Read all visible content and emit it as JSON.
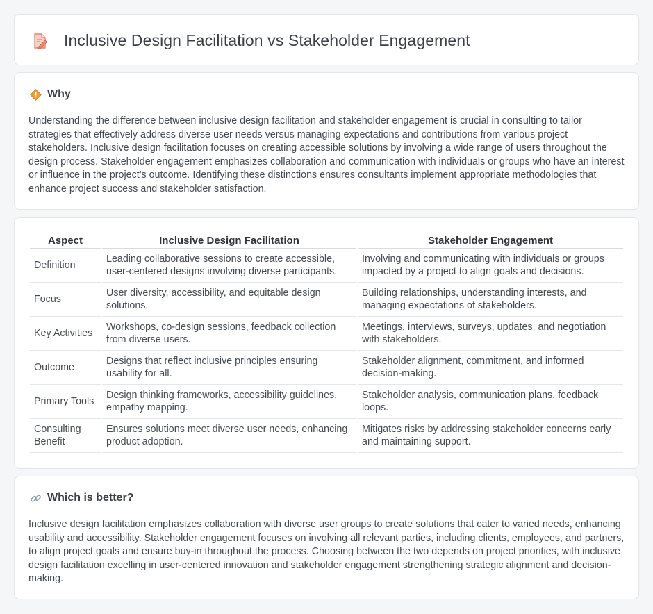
{
  "header": {
    "title": "Inclusive Design Facilitation vs Stakeholder Engagement",
    "icon": "document-edit-icon"
  },
  "why": {
    "title": "Why",
    "icon": "diamond-sign-icon",
    "body": "Understanding the difference between inclusive design facilitation and stakeholder engagement is crucial in consulting to tailor strategies that effectively address diverse user needs versus managing expectations and contributions from various project stakeholders. Inclusive design facilitation focuses on creating accessible solutions by involving a wide range of users throughout the design process. Stakeholder engagement emphasizes collaboration and communication with individuals or groups who have an interest or influence in the project's outcome. Identifying these distinctions ensures consultants implement appropriate methodologies that enhance project success and stakeholder satisfaction."
  },
  "table": {
    "headers": [
      "Aspect",
      "Inclusive Design Facilitation",
      "Stakeholder Engagement"
    ],
    "rows": [
      {
        "aspect": "Definition",
        "idf": "Leading collaborative sessions to create accessible, user-centered designs involving diverse participants.",
        "se": "Involving and communicating with individuals or groups impacted by a project to align goals and decisions."
      },
      {
        "aspect": "Focus",
        "idf": "User diversity, accessibility, and equitable design solutions.",
        "se": "Building relationships, understanding interests, and managing expectations of stakeholders."
      },
      {
        "aspect": "Key Activities",
        "idf": "Workshops, co-design sessions, feedback collection from diverse users.",
        "se": "Meetings, interviews, surveys, updates, and negotiation with stakeholders."
      },
      {
        "aspect": "Outcome",
        "idf": "Designs that reflect inclusive principles ensuring usability for all.",
        "se": "Stakeholder alignment, commitment, and informed decision-making."
      },
      {
        "aspect": "Primary Tools",
        "idf": "Design thinking frameworks, accessibility guidelines, empathy mapping.",
        "se": "Stakeholder analysis, communication plans, feedback loops."
      },
      {
        "aspect": "Consulting Benefit",
        "idf": "Ensures solutions meet diverse user needs, enhancing product adoption.",
        "se": "Mitigates risks by addressing stakeholder concerns early and maintaining support."
      }
    ]
  },
  "better": {
    "title": "Which is better?",
    "icon": "link-icon",
    "body": "Inclusive design facilitation emphasizes collaboration with diverse user groups to create solutions that cater to varied needs, enhancing usability and accessibility. Stakeholder engagement focuses on involving all relevant parties, including clients, employees, and partners, to align project goals and ensure buy-in throughout the process. Choosing between the two depends on project priorities, with inclusive design facilitation excelling in user-centered innovation and stakeholder engagement strengthening strategic alignment and decision-making."
  },
  "colors": {
    "background": "#f5f6f8",
    "card": "#ffffff",
    "icon_accent": "#e8826b",
    "sign_accent": "#f0a030"
  }
}
